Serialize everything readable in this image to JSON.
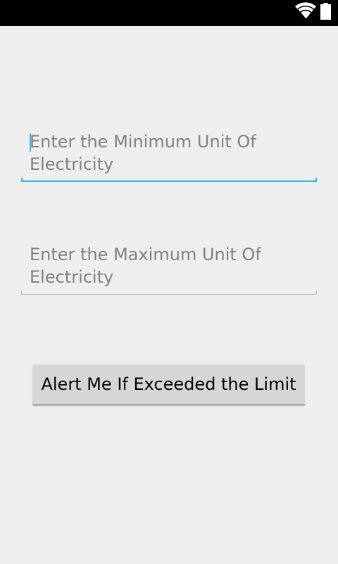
{
  "status_bar": {
    "icons": [
      "wifi-icon",
      "battery-icon"
    ],
    "background": "#000000"
  },
  "form": {
    "min_field": {
      "placeholder": "Enter the Minimum Unit Of Electricity",
      "value": "",
      "focused": true
    },
    "max_field": {
      "placeholder": "Enter the Maximum Unit Of Electricity",
      "value": "",
      "focused": false
    },
    "alert_button_label": "Alert Me If Exceeded the Limit"
  },
  "colors": {
    "accent": "#33b5e5",
    "background": "#eeeeee",
    "hint_text": "#808080",
    "button": "#d6d6d6"
  }
}
